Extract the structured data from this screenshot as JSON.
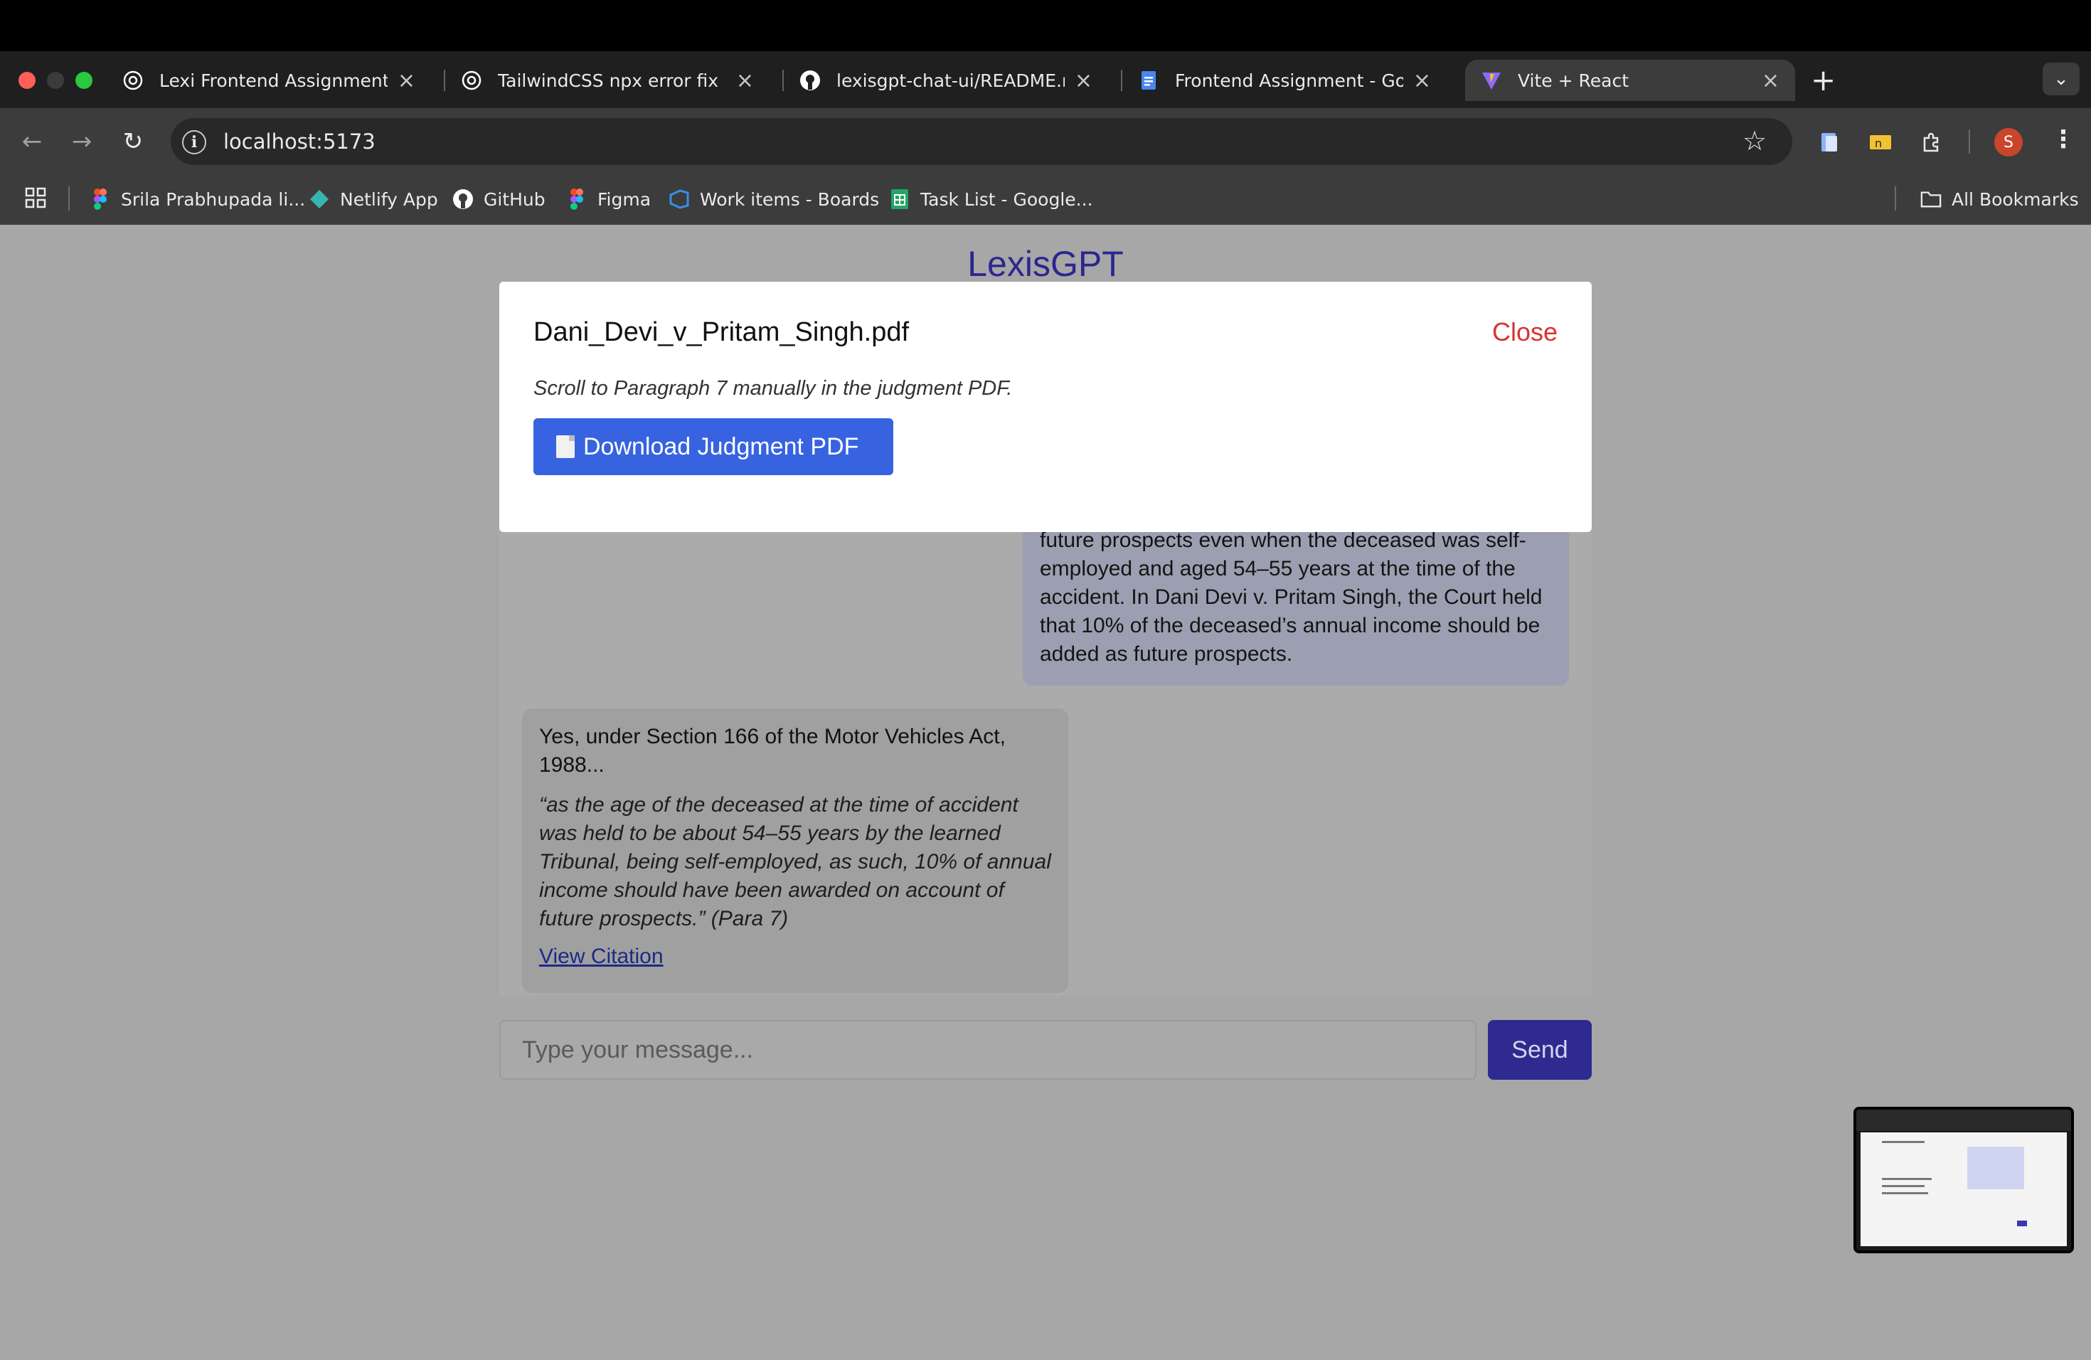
{
  "browser": {
    "tabs": [
      {
        "title": "Lexi Frontend Assignment",
        "icon": "openai-icon"
      },
      {
        "title": "TailwindCSS npx error fix",
        "icon": "openai-icon"
      },
      {
        "title": "lexisgpt-chat-ui/README.md",
        "icon": "github-icon"
      },
      {
        "title": "Frontend Assignment - Google Docs",
        "icon": "google-docs-icon"
      },
      {
        "title": "Vite + React",
        "icon": "vite-icon",
        "active": true
      }
    ],
    "url": "localhost:5173",
    "profile_initial": "S",
    "bookmarks": [
      {
        "label": "Srila Prabhupada li...",
        "icon": "figma-icon"
      },
      {
        "label": "Netlify App",
        "icon": "netlify-icon"
      },
      {
        "label": "GitHub",
        "icon": "github-icon"
      },
      {
        "label": "Figma",
        "icon": "figma-icon"
      },
      {
        "label": "Work items - Boards",
        "icon": "azure-devops-icon"
      },
      {
        "label": "Task List - Google...",
        "icon": "google-sheets-icon"
      }
    ],
    "all_bookmarks": "All Bookmarks"
  },
  "app": {
    "title": "LexisGPT",
    "user_message": "future prospects even when the deceased was self-employed and aged 54–55 years at the time of the accident. In Dani Devi v. Pritam Singh, the Court held that 10% of the deceased’s annual income should be added as future prospects.",
    "assistant_message": {
      "lead": "Yes, under Section 166 of the Motor Vehicles Act, 1988...",
      "quote": "“as the age of the deceased at the time of accident was held to be about 54–55 years by the learned Tribunal, being self-employed, as such, 10% of annual income should have been awarded on account of future prospects.” (Para 7)",
      "citation_link": "View Citation"
    },
    "input_placeholder": "Type your message...",
    "send_label": "Send"
  },
  "modal": {
    "title": "Dani_Devi_v_Pritam_Singh.pdf",
    "close_label": "Close",
    "note": "Scroll to Paragraph 7 manually in the judgment PDF.",
    "download_label": "Download Judgment PDF"
  },
  "colors": {
    "brand": "#2c2690",
    "modal_button": "#3763e0",
    "close": "#d7342f"
  }
}
